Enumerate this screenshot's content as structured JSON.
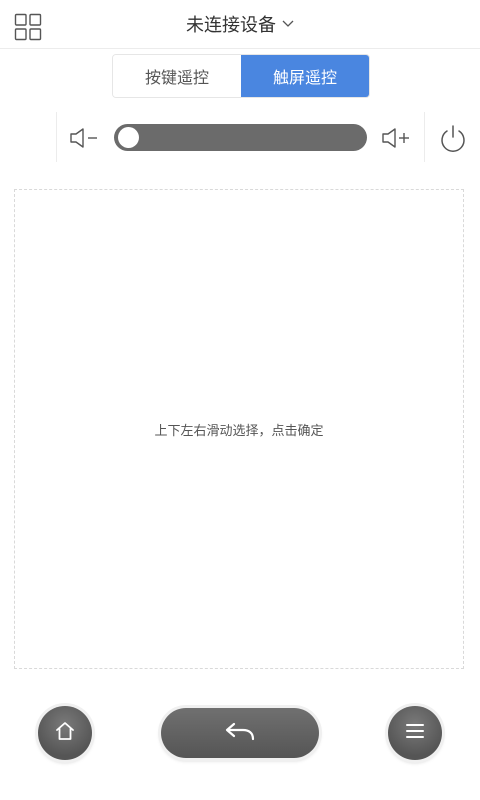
{
  "header": {
    "title": "未连接设备"
  },
  "tabs": [
    {
      "label": "按键遥控",
      "active": false
    },
    {
      "label": "触屏遥控",
      "active": true
    }
  ],
  "controls": {
    "grid_icon": "grid-icon",
    "volume_down_icon": "volume-down-icon",
    "volume_up_icon": "volume-up-icon",
    "power_icon": "power-icon",
    "volume_level": 0
  },
  "touchpad": {
    "hint": "上下左右滑动选择，点击确定"
  },
  "nav": {
    "home_icon": "home-icon",
    "back_icon": "back-icon",
    "menu_icon": "menu-icon"
  },
  "colors": {
    "accent": "#4a86e0",
    "slider": "#6b6b6b",
    "button": "#5c5c5c"
  }
}
